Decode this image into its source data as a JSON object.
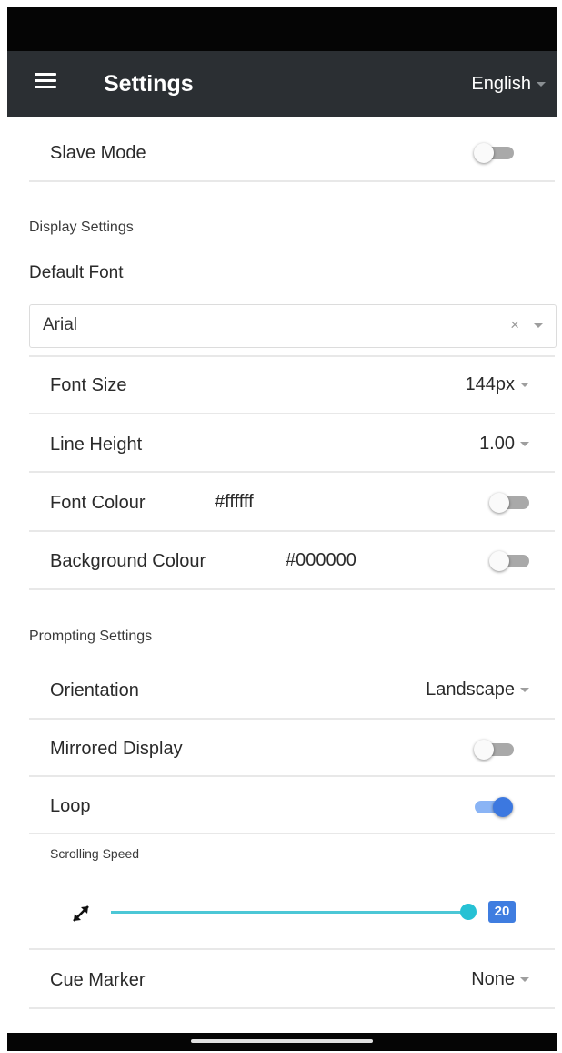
{
  "app_bar": {
    "title": "Settings",
    "language": "English"
  },
  "slave_mode": {
    "label": "Slave Mode",
    "on": false
  },
  "display": {
    "section_title": "Display Settings",
    "default_font_label": "Default Font",
    "default_font_value": "Arial",
    "clear_symbol": "×",
    "font_size": {
      "label": "Font Size",
      "value": "144px"
    },
    "line_height": {
      "label": "Line Height",
      "value": "1.00"
    },
    "font_colour": {
      "label": "Font Colour",
      "value": "#ffffff",
      "on": false
    },
    "background_colour": {
      "label": "Background Colour",
      "value": "#000000",
      "on": false
    }
  },
  "prompting": {
    "section_title": "Prompting Settings",
    "orientation": {
      "label": "Orientation",
      "value": "Landscape"
    },
    "mirrored_display": {
      "label": "Mirrored Display",
      "on": false
    },
    "loop": {
      "label": "Loop",
      "on": true
    },
    "scrolling_speed": {
      "label": "Scrolling Speed",
      "value": "20",
      "icon": "resize-diagonal-icon"
    },
    "cue_marker": {
      "label": "Cue Marker",
      "value": "None"
    }
  },
  "colors": {
    "app_bar": "#2b2f33",
    "accent_blue": "#3c78e0",
    "slider": "#26c1d4"
  }
}
